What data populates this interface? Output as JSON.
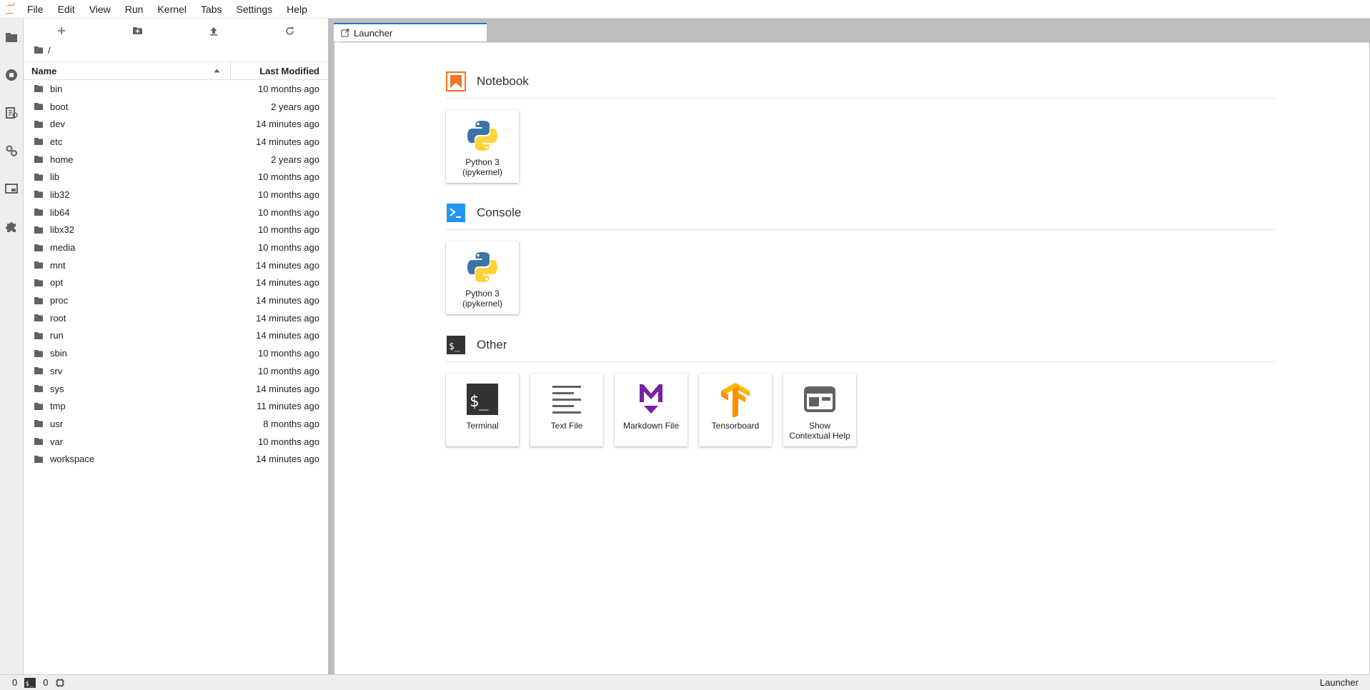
{
  "menubar": {
    "items": [
      "File",
      "Edit",
      "View",
      "Run",
      "Kernel",
      "Tabs",
      "Settings",
      "Help"
    ]
  },
  "filebrowser": {
    "breadcrumb": "/",
    "columns": {
      "name": "Name",
      "modified": "Last Modified"
    },
    "files": [
      {
        "name": "bin",
        "modified": "10 months ago"
      },
      {
        "name": "boot",
        "modified": "2 years ago"
      },
      {
        "name": "dev",
        "modified": "14 minutes ago"
      },
      {
        "name": "etc",
        "modified": "14 minutes ago"
      },
      {
        "name": "home",
        "modified": "2 years ago"
      },
      {
        "name": "lib",
        "modified": "10 months ago"
      },
      {
        "name": "lib32",
        "modified": "10 months ago"
      },
      {
        "name": "lib64",
        "modified": "10 months ago"
      },
      {
        "name": "libx32",
        "modified": "10 months ago"
      },
      {
        "name": "media",
        "modified": "10 months ago"
      },
      {
        "name": "mnt",
        "modified": "14 minutes ago"
      },
      {
        "name": "opt",
        "modified": "14 minutes ago"
      },
      {
        "name": "proc",
        "modified": "14 minutes ago"
      },
      {
        "name": "root",
        "modified": "14 minutes ago"
      },
      {
        "name": "run",
        "modified": "14 minutes ago"
      },
      {
        "name": "sbin",
        "modified": "10 months ago"
      },
      {
        "name": "srv",
        "modified": "10 months ago"
      },
      {
        "name": "sys",
        "modified": "14 minutes ago"
      },
      {
        "name": "tmp",
        "modified": "11 minutes ago"
      },
      {
        "name": "usr",
        "modified": "8 months ago"
      },
      {
        "name": "var",
        "modified": "10 months ago"
      },
      {
        "name": "workspace",
        "modified": "14 minutes ago"
      }
    ]
  },
  "tab": {
    "label": "Launcher"
  },
  "launcher": {
    "notebook": {
      "title": "Notebook",
      "cards": [
        {
          "label": "Python 3\n(ipykernel)"
        }
      ]
    },
    "console": {
      "title": "Console",
      "cards": [
        {
          "label": "Python 3\n(ipykernel)"
        }
      ]
    },
    "other": {
      "title": "Other",
      "cards": [
        {
          "label": "Terminal"
        },
        {
          "label": "Text File"
        },
        {
          "label": "Markdown File"
        },
        {
          "label": "Tensorboard"
        },
        {
          "label": "Show\nContextual Help"
        }
      ]
    }
  },
  "statusbar": {
    "kernels": "0",
    "terminals": "0",
    "mode": "Launcher"
  },
  "colors": {
    "accent": "#1976d2",
    "notebook": "#f37626",
    "console": "#2196f3",
    "markdown": "#7b1fa2",
    "tensorboard": "#ff9800"
  }
}
